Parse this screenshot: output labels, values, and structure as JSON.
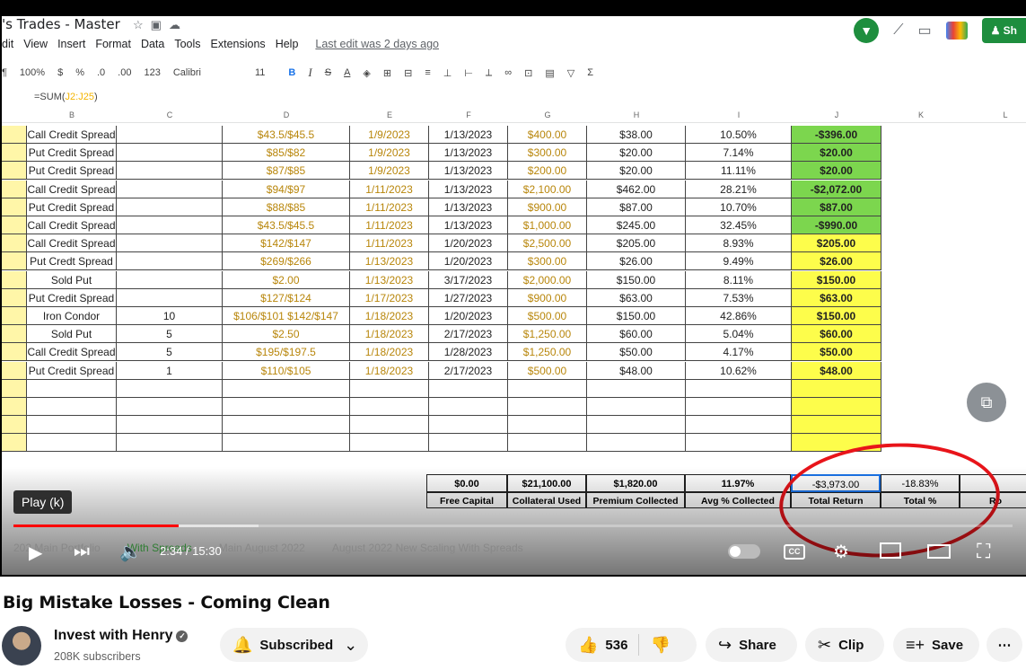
{
  "sheets": {
    "doc_title": "'s Trades - Master",
    "menu": [
      "dit",
      "View",
      "Insert",
      "Format",
      "Data",
      "Tools",
      "Extensions",
      "Help"
    ],
    "last_edit": "Last edit was 2 days ago",
    "share_label": "Sh",
    "toolbar": {
      "zoom": "100%",
      "currency": "$",
      "percent": "%",
      "dec_less": ".0",
      "dec_more": ".00",
      "number_format": "123",
      "font": "Calibri",
      "size": "11",
      "bold": "B",
      "italic": "I",
      "strike": "S",
      "text_color": "A"
    },
    "formula": {
      "prefix": "=SUM(",
      "ref": "J2:J25",
      "suffix": ")"
    },
    "columns": [
      "B",
      "C",
      "D",
      "E",
      "F",
      "G",
      "H",
      "I",
      "J",
      "K",
      "L"
    ],
    "rows": [
      {
        "strategy": "Call Credit Spread",
        "qty": "",
        "strikes": "$43.5/$45.5",
        "open": "1/9/2023",
        "exp": "1/13/2023",
        "collateral": "$400.00",
        "premium": "$38.00",
        "pct": "10.50%",
        "ret": "-$396.00",
        "color": "green"
      },
      {
        "strategy": "Put Credit Spread",
        "qty": "",
        "strikes": "$85/$82",
        "open": "1/9/2023",
        "exp": "1/13/2023",
        "collateral": "$300.00",
        "premium": "$20.00",
        "pct": "7.14%",
        "ret": "$20.00",
        "color": "green"
      },
      {
        "strategy": "Put Credit Spread",
        "qty": "",
        "strikes": "$87/$85",
        "open": "1/9/2023",
        "exp": "1/13/2023",
        "collateral": "$200.00",
        "premium": "$20.00",
        "pct": "11.11%",
        "ret": "$20.00",
        "color": "green"
      },
      {
        "strategy": "Call Credit Spread",
        "qty": "",
        "strikes": "$94/$97",
        "open": "1/11/2023",
        "exp": "1/13/2023",
        "collateral": "$2,100.00",
        "premium": "$462.00",
        "pct": "28.21%",
        "ret": "-$2,072.00",
        "color": "green"
      },
      {
        "strategy": "Put Credit Spread",
        "qty": "",
        "strikes": "$88/$85",
        "open": "1/11/2023",
        "exp": "1/13/2023",
        "collateral": "$900.00",
        "premium": "$87.00",
        "pct": "10.70%",
        "ret": "$87.00",
        "color": "green"
      },
      {
        "strategy": "Call Credit Spread",
        "qty": "",
        "strikes": "$43.5/$45.5",
        "open": "1/11/2023",
        "exp": "1/13/2023",
        "collateral": "$1,000.00",
        "premium": "$245.00",
        "pct": "32.45%",
        "ret": "-$990.00",
        "color": "green"
      },
      {
        "strategy": "Call Credit Spread",
        "qty": "",
        "strikes": "$142/$147",
        "open": "1/11/2023",
        "exp": "1/20/2023",
        "collateral": "$2,500.00",
        "premium": "$205.00",
        "pct": "8.93%",
        "ret": "$205.00",
        "color": "yellow"
      },
      {
        "strategy": "Put Credt Spread",
        "qty": "",
        "strikes": "$269/$266",
        "open": "1/13/2023",
        "exp": "1/20/2023",
        "collateral": "$300.00",
        "premium": "$26.00",
        "pct": "9.49%",
        "ret": "$26.00",
        "color": "yellow"
      },
      {
        "strategy": "Sold Put",
        "qty": "",
        "strikes": "$2.00",
        "open": "1/13/2023",
        "exp": "3/17/2023",
        "collateral": "$2,000.00",
        "premium": "$150.00",
        "pct": "8.11%",
        "ret": "$150.00",
        "color": "yellow"
      },
      {
        "strategy": "Put Credit Spread",
        "qty": "",
        "strikes": "$127/$124",
        "open": "1/17/2023",
        "exp": "1/27/2023",
        "collateral": "$900.00",
        "premium": "$63.00",
        "pct": "7.53%",
        "ret": "$63.00",
        "color": "yellow"
      },
      {
        "strategy": "Iron Condor",
        "qty": "10",
        "strikes": "$106/$101   $142/$147",
        "open": "1/18/2023",
        "exp": "1/20/2023",
        "collateral": "$500.00",
        "premium": "$150.00",
        "pct": "42.86%",
        "ret": "$150.00",
        "color": "yellow"
      },
      {
        "strategy": "Sold Put",
        "qty": "5",
        "strikes": "$2.50",
        "open": "1/18/2023",
        "exp": "2/17/2023",
        "collateral": "$1,250.00",
        "premium": "$60.00",
        "pct": "5.04%",
        "ret": "$60.00",
        "color": "yellow"
      },
      {
        "strategy": "Call Credit Spread",
        "qty": "5",
        "strikes": "$195/$197.5",
        "open": "1/18/2023",
        "exp": "1/28/2023",
        "collateral": "$1,250.00",
        "premium": "$50.00",
        "pct": "4.17%",
        "ret": "$50.00",
        "color": "yellow"
      },
      {
        "strategy": "Put Credit Spread",
        "qty": "1",
        "strikes": "$110/$105",
        "open": "1/18/2023",
        "exp": "2/17/2023",
        "collateral": "$500.00",
        "premium": "$48.00",
        "pct": "10.62%",
        "ret": "$48.00",
        "color": "yellow"
      }
    ],
    "summary": [
      {
        "value": "$0.00",
        "label": "Free Capital"
      },
      {
        "value": "$21,100.00",
        "label": "Collateral Used"
      },
      {
        "value": "$1,820.00",
        "label": "Premium Collected"
      },
      {
        "value": "11.97%",
        "label": "Avg % Collected"
      },
      {
        "value": "-$3,973.00",
        "label": "Total Return"
      },
      {
        "value": "-18.83%",
        "label": "Total %"
      },
      {
        "value": "",
        "label": "Ro"
      }
    ],
    "tabs": [
      "202 Main Portfolio",
      "With Spreads",
      "Main August 2022",
      "August 2022 New Scaling With Spreads"
    ]
  },
  "player": {
    "tooltip": "Play (k)",
    "time": "2:34 / 15:30",
    "progress_played": 0.165,
    "progress_loaded": 0.245,
    "cc_label": "CC"
  },
  "video": {
    "title": "Big Mistake Losses - Coming Clean",
    "channel": "Invest with Henry",
    "subscribers": "208K subscribers",
    "subscribed_label": "Subscribed",
    "likes": "536",
    "share_label": "Share",
    "clip_label": "Clip",
    "save_label": "Save"
  },
  "colors": {
    "green_cell": "#7cd64e",
    "yellow_cell": "#fdfd4b",
    "annotation_red": "#e8141a",
    "progress_red": "#ff0000"
  }
}
